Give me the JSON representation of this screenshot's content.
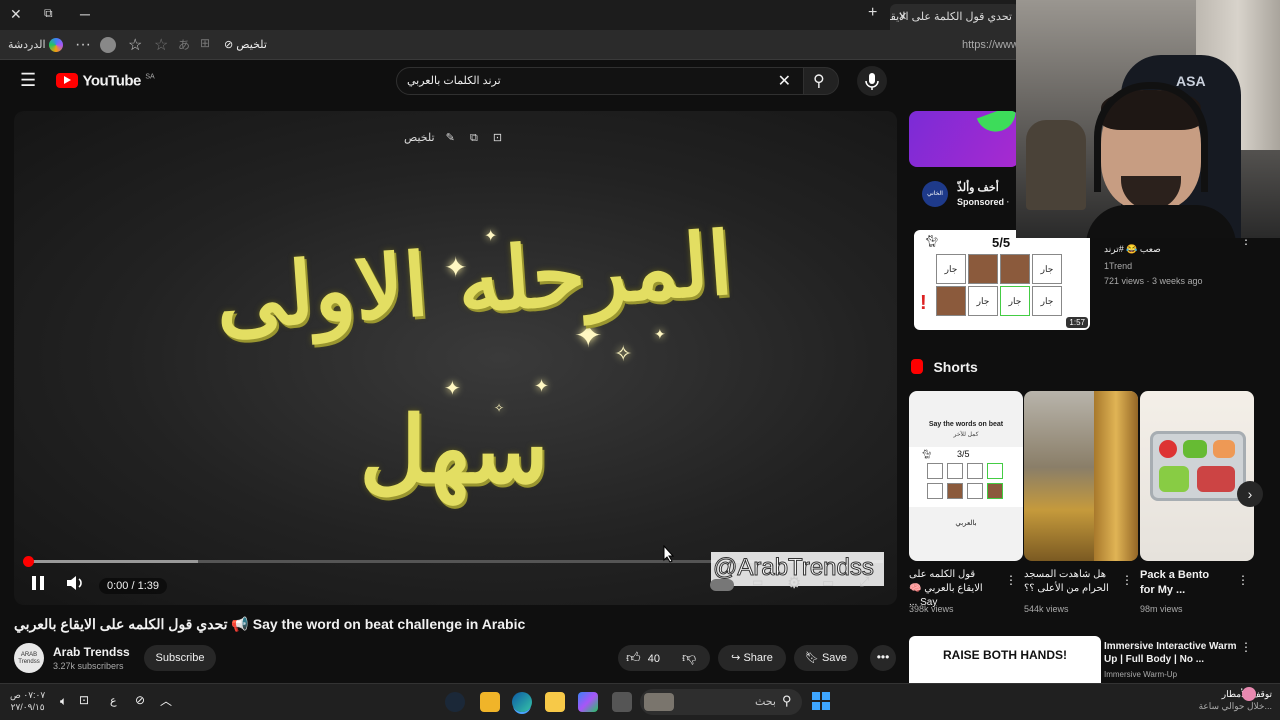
{
  "browser": {
    "tab_title": "تحدي قول الكلمة على الايقاع بال",
    "url": "https://www.",
    "chat_label": "الدردشة",
    "summarize_label": "تلخيص"
  },
  "youtube": {
    "logo_text": "YouTube",
    "region": "SA",
    "search_value": "ترند الكلمات بالعربي"
  },
  "player": {
    "overlay_summarize": "تلخيص",
    "video_text_line1": "المرحله الاولى",
    "video_text_line2": "سهل",
    "time": "0:00 / 1:39",
    "progress": 0.0,
    "watermark": "@ArabTrendss"
  },
  "video": {
    "title": "تحدي قول الكلمه على الايقاع بالعربي 📢 Say the word on beat challenge in Arabic",
    "channel_name": "Arab Trendss",
    "channel_avatar_text": "ARAB Trendss",
    "subscribers": "3.27k subscribers",
    "subscribe_label": "Subscribe",
    "likes": "40",
    "share_label": "Share",
    "save_label": "Save"
  },
  "sidebar": {
    "ad": {
      "title": "أخف وألذّ",
      "sponsored": "Sponsored",
      "dot": "·",
      "avatar_text": "الخاني"
    },
    "rec1": {
      "title": "صعب 😂 #ترند",
      "channel": "1Trend",
      "meta": "721 views · 3 weeks ago",
      "duration": "1:57",
      "score": "5/5",
      "cell_text": "جار"
    },
    "shorts_heading": "Shorts",
    "shorts": [
      {
        "title": "قول الكلمه على الايقاع بالعربي 🧠 Say ...",
        "views": "398k views",
        "thumb_header": "Say the words on beat",
        "thumb_sub": "كمل للآخر",
        "thumb_score": "3/5",
        "thumb_footer": "بالعربي"
      },
      {
        "title": "هل شاهدت المسجد الحرام من الأعلى ؟؟",
        "views": "544k views"
      },
      {
        "title": "Pack a Bento for My ...",
        "views": "98m views"
      }
    ],
    "next_video": {
      "thumb_text": "RAISE BOTH HANDS!",
      "title": "Immersive Interactive Warm Up | Full Body | No ...",
      "channel": "Immersive Warm-Up"
    }
  },
  "webcam": {
    "chair_text": "ASA"
  },
  "taskbar": {
    "time": "٠٧:٠٧ ص",
    "date": "٢٧/٠٩/١٥",
    "search_placeholder": "بحث",
    "lang": "ع",
    "weather_title": "توقف الأمطار",
    "weather_sub": "خلال حوالي ساعة..."
  }
}
